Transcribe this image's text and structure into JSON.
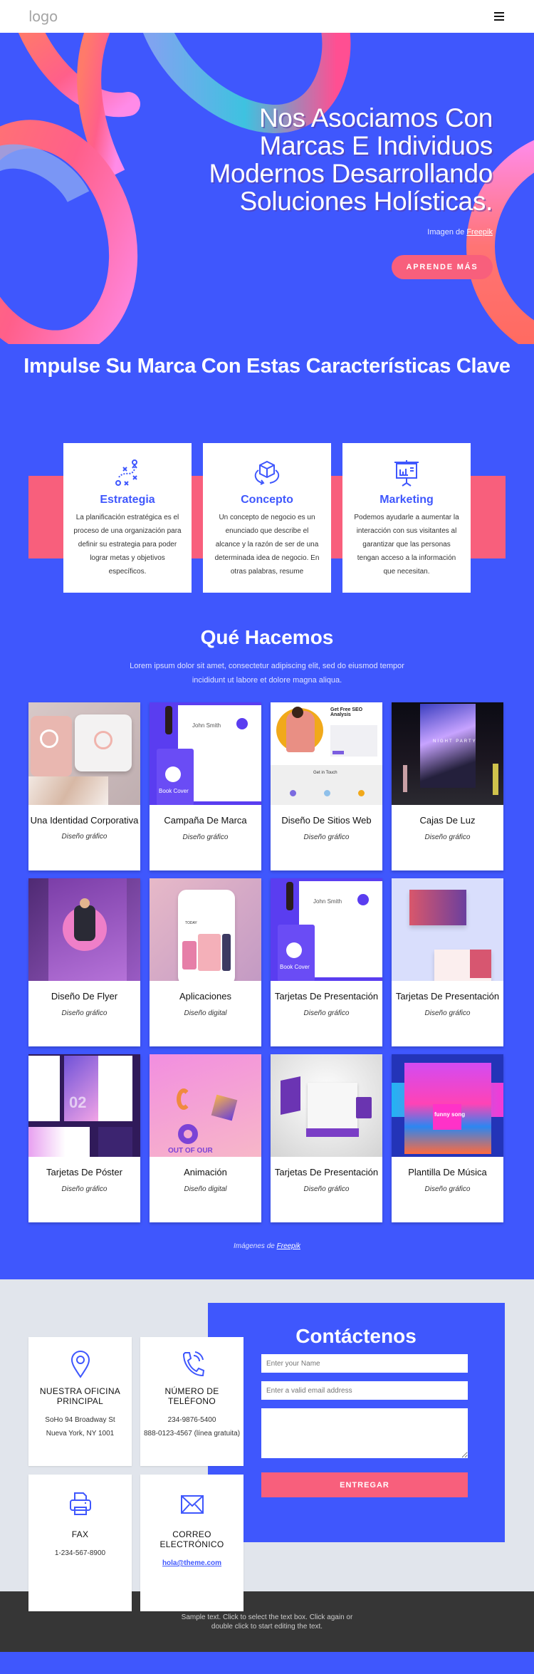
{
  "header": {
    "logo": "logo",
    "menu_icon": "hamburger-menu-icon"
  },
  "hero": {
    "title": "Nos Asociamos Con Marcas E Individuos Modernos Desarrollando Soluciones Holísticas.",
    "credit_prefix": "Imagen de ",
    "credit_link": "Freepik",
    "cta_label": "APRENDE MÁS"
  },
  "features": {
    "title": "Impulse Su Marca Con Estas Características Clave",
    "cards": [
      {
        "icon": "strategy-play-icon",
        "title": "Estrategia",
        "text": "La planificación estratégica es el proceso de una organización para definir su estrategia para poder lograr metas y objetivos específicos."
      },
      {
        "icon": "cube-rotate-icon",
        "title": "Concepto",
        "text": "Un concepto de negocio es un enunciado que describe el alcance y la razón de ser de una determinada idea de negocio. En otras palabras, resume"
      },
      {
        "icon": "presentation-chart-icon",
        "title": "Marketing",
        "text": "Podemos ayudarle a aumentar la interacción con sus visitantes al garantizar que las personas tengan acceso a la información que necesitan."
      }
    ]
  },
  "work": {
    "title": "Qué Hacemos",
    "subtitle": "Lorem ipsum dolor sit amet, consectetur adipiscing elit, sed do eiusmod tempor incididunt ut labore et dolore magna aliqua.",
    "items": [
      {
        "title": "Una Identidad Corporativa",
        "category": "Diseño gráfico",
        "thumb": "business-cards-marble"
      },
      {
        "title": "Campaña De Marca",
        "category": "Diseño gráfico",
        "thumb": "book-cover-stationery"
      },
      {
        "title": "Diseño De Sitios Web",
        "category": "Diseño gráfico",
        "thumb": "seo-website"
      },
      {
        "title": "Cajas De Luz",
        "category": "Diseño gráfico",
        "thumb": "night-party-lightbox"
      },
      {
        "title": "Diseño De Flyer",
        "category": "Diseño gráfico",
        "thumb": "flyer-purple"
      },
      {
        "title": "Aplicaciones",
        "category": "Diseño digital",
        "thumb": "phone-mockup"
      },
      {
        "title": "Tarjetas De Presentación",
        "category": "Diseño gráfico",
        "thumb": "book-cover-stationery"
      },
      {
        "title": "Tarjetas De Presentación",
        "category": "Diseño gráfico",
        "thumb": "business-cards-colorful"
      },
      {
        "title": "Tarjetas De Póster",
        "category": "Diseño gráfico",
        "thumb": "poster-layout"
      },
      {
        "title": "Animación",
        "category": "Diseño digital",
        "thumb": "3d-shapes-pink"
      },
      {
        "title": "Tarjetas De Presentación",
        "category": "Diseño gráfico",
        "thumb": "calendar-mug"
      },
      {
        "title": "Plantilla De Música",
        "category": "Diseño gráfico",
        "thumb": "karaoke-poster"
      }
    ],
    "credit_prefix": "Imágenes de ",
    "credit_link": "Freepik"
  },
  "contact": {
    "cards": [
      {
        "icon": "location-pin-icon",
        "title": "NUESTRA OFICINA PRINCIPAL",
        "lines": [
          "SoHo 94 Broadway St",
          "Nueva York, NY 1001"
        ]
      },
      {
        "icon": "phone-icon",
        "title": "NÚMERO DE TELÉFONO",
        "lines": [
          "234-9876-5400",
          "888-0123-4567 (línea gratuita)"
        ]
      },
      {
        "icon": "fax-printer-icon",
        "title": "FAX",
        "lines": [
          "1-234-567-8900"
        ]
      },
      {
        "icon": "envelope-icon",
        "title": "CORREO ELECTRÓNICO",
        "email": "hola@theme.com"
      }
    ],
    "form": {
      "title": "Contáctenos",
      "name_placeholder": "Enter your Name",
      "email_placeholder": "Enter a valid email address",
      "message_placeholder": "",
      "submit_label": "ENTREGAR"
    }
  },
  "footer": {
    "text": "Sample text. Click to select the text box. Click again or double click to start editing the text."
  },
  "colors": {
    "primary_blue": "#3f57fd",
    "accent_pink": "#f85f7c",
    "light_gray": "#e1e5ec",
    "footer_dark": "#363636"
  }
}
